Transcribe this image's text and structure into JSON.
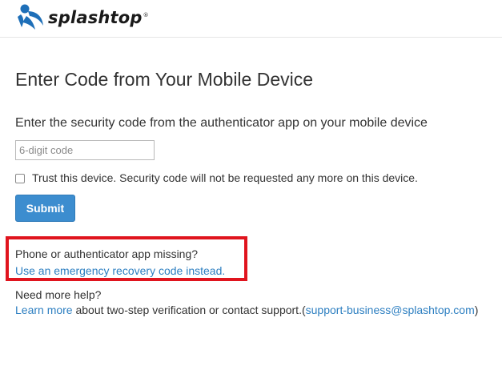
{
  "brand": {
    "name": "splashtop",
    "trademark": "®",
    "accent_color": "#1e6fb8"
  },
  "main": {
    "title": "Enter Code from Your Mobile Device",
    "instruction": "Enter the security code from the authenticator app on your mobile device",
    "code_input": {
      "placeholder": "6-digit code",
      "value": ""
    },
    "trust_device": {
      "checked": false,
      "label": "Trust this device. Security code will not be requested any more on this device."
    },
    "submit_label": "Submit",
    "submit_color": "#3c8dcf"
  },
  "recovery": {
    "question": "Phone or authenticator app missing?",
    "link_text": "Use an emergency recovery code instead.",
    "highlight_color": "#e0141e"
  },
  "help": {
    "question": "Need more help?",
    "learn_more_text": "Learn more",
    "middle_text": " about two-step verification or contact support.(",
    "support_email": "support-business@splashtop.com",
    "closing_text": ")",
    "link_color": "#2d7fc1"
  }
}
